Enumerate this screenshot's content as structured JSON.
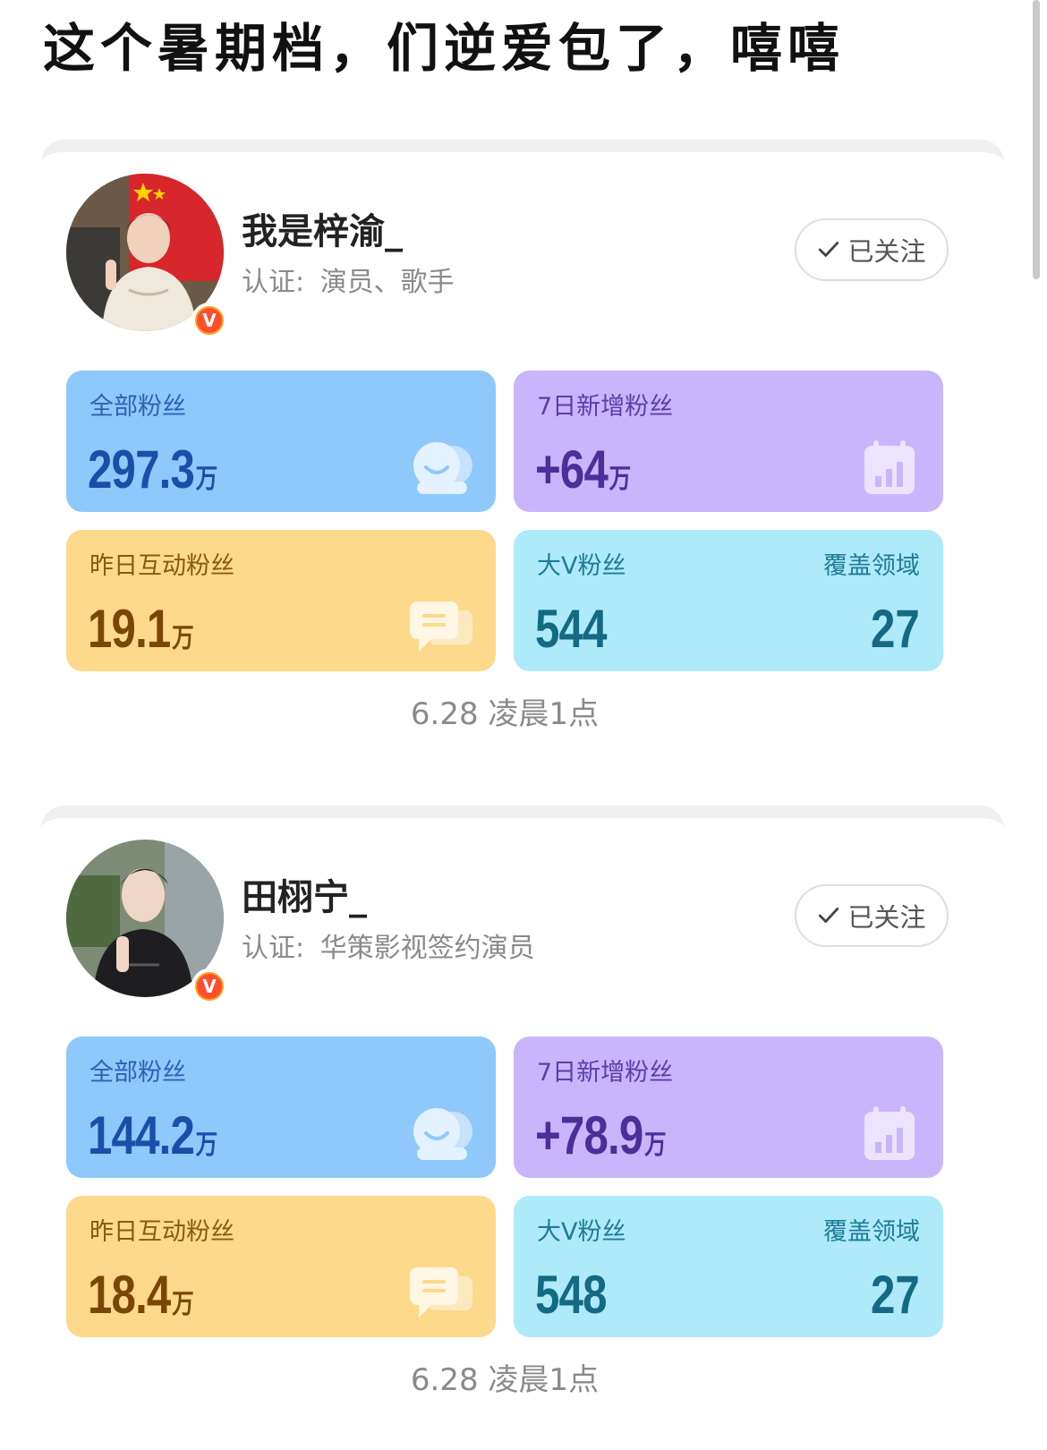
{
  "page_title": "这个暑期档，们逆爱包了，嘻嘻",
  "profiles": [
    {
      "name": "我是梓渝_",
      "cert_label": "认证:",
      "cert_value": "演员、歌手",
      "follow_label": "已关注",
      "stats": {
        "all_fans": {
          "label": "全部粉丝",
          "value": "297.3",
          "unit": "万"
        },
        "new_fans_7d": {
          "label": "7日新增粉丝",
          "value": "+64",
          "unit": "万"
        },
        "interactive_fans": {
          "label": "昨日互动粉丝",
          "value": "19.1",
          "unit": "万"
        },
        "big_v_fans": {
          "label": "大V粉丝",
          "value": "544",
          "coverage_label": "覆盖领域",
          "coverage_value": "27"
        }
      },
      "timestamp": "6.28 凌晨1点"
    },
    {
      "name": "田栩宁_",
      "cert_label": "认证:",
      "cert_value": "华策影视签约演员",
      "follow_label": "已关注",
      "stats": {
        "all_fans": {
          "label": "全部粉丝",
          "value": "144.2",
          "unit": "万"
        },
        "new_fans_7d": {
          "label": "7日新增粉丝",
          "value": "+78.9",
          "unit": "万"
        },
        "interactive_fans": {
          "label": "昨日互动粉丝",
          "value": "18.4",
          "unit": "万"
        },
        "big_v_fans": {
          "label": "大V粉丝",
          "value": "548",
          "coverage_label": "覆盖领域",
          "coverage_value": "27"
        }
      },
      "timestamp": "6.28 凌晨1点"
    }
  ],
  "colors": {
    "fans_tile": "#8fc8fb",
    "new_fans_tile": "#c9b5fb",
    "interactive_tile": "#fdd98b",
    "bigv_tile": "#aeeaf9",
    "verified_badge": "#ff4d2d"
  },
  "icons": [
    "check-icon",
    "fans-face-icon",
    "calendar-chart-icon",
    "chat-bubble-icon",
    "verified-v-icon"
  ]
}
